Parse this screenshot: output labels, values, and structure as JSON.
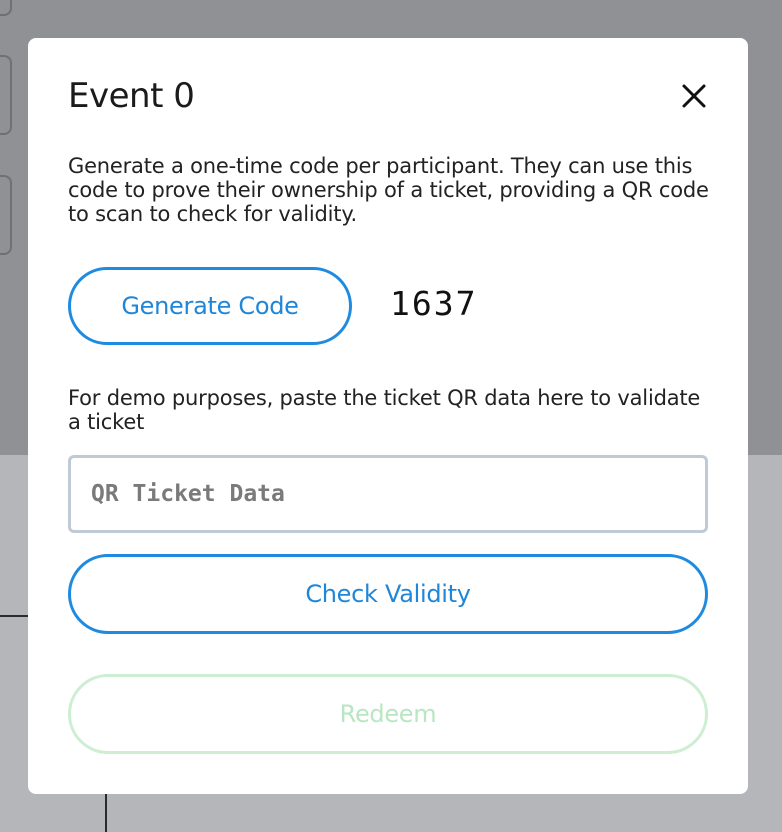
{
  "modal": {
    "title": "Event 0",
    "close_icon": "close-icon",
    "description": "Generate a one-time code per participant. They can use this code to prove their ownership of a ticket, providing a QR code to scan to check for validity.",
    "generate_button_label": "Generate Code",
    "generated_code": "1637",
    "demo_hint": "For demo purposes, paste the ticket QR data here to validate a ticket",
    "qr_input": {
      "value": "",
      "placeholder": "QR Ticket Data"
    },
    "check_button_label": "Check Validity",
    "redeem_button_label": "Redeem",
    "redeem_disabled": true
  },
  "colors": {
    "accent": "#1f8be0",
    "backdrop": "#8f9195",
    "redeem_disabled_border": "#cdeed3",
    "redeem_disabled_text": "#b9e6c2"
  }
}
